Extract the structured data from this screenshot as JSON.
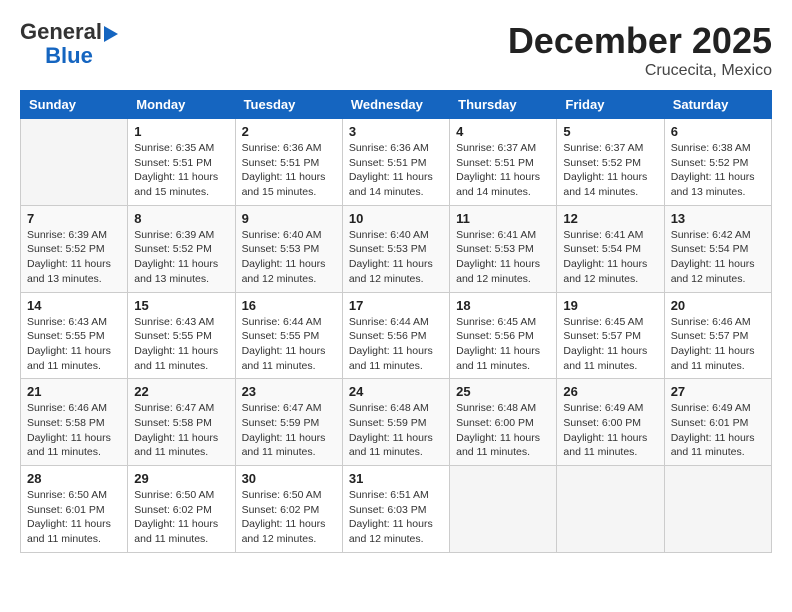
{
  "header": {
    "logo_general": "General",
    "logo_blue": "Blue",
    "month_title": "December 2025",
    "subtitle": "Crucecita, Mexico"
  },
  "weekdays": [
    "Sunday",
    "Monday",
    "Tuesday",
    "Wednesday",
    "Thursday",
    "Friday",
    "Saturday"
  ],
  "weeks": [
    [
      {
        "day": "",
        "sunrise": "",
        "sunset": "",
        "daylight": ""
      },
      {
        "day": "1",
        "sunrise": "Sunrise: 6:35 AM",
        "sunset": "Sunset: 5:51 PM",
        "daylight": "Daylight: 11 hours and 15 minutes."
      },
      {
        "day": "2",
        "sunrise": "Sunrise: 6:36 AM",
        "sunset": "Sunset: 5:51 PM",
        "daylight": "Daylight: 11 hours and 15 minutes."
      },
      {
        "day": "3",
        "sunrise": "Sunrise: 6:36 AM",
        "sunset": "Sunset: 5:51 PM",
        "daylight": "Daylight: 11 hours and 14 minutes."
      },
      {
        "day": "4",
        "sunrise": "Sunrise: 6:37 AM",
        "sunset": "Sunset: 5:51 PM",
        "daylight": "Daylight: 11 hours and 14 minutes."
      },
      {
        "day": "5",
        "sunrise": "Sunrise: 6:37 AM",
        "sunset": "Sunset: 5:52 PM",
        "daylight": "Daylight: 11 hours and 14 minutes."
      },
      {
        "day": "6",
        "sunrise": "Sunrise: 6:38 AM",
        "sunset": "Sunset: 5:52 PM",
        "daylight": "Daylight: 11 hours and 13 minutes."
      }
    ],
    [
      {
        "day": "7",
        "sunrise": "Sunrise: 6:39 AM",
        "sunset": "Sunset: 5:52 PM",
        "daylight": "Daylight: 11 hours and 13 minutes."
      },
      {
        "day": "8",
        "sunrise": "Sunrise: 6:39 AM",
        "sunset": "Sunset: 5:52 PM",
        "daylight": "Daylight: 11 hours and 13 minutes."
      },
      {
        "day": "9",
        "sunrise": "Sunrise: 6:40 AM",
        "sunset": "Sunset: 5:53 PM",
        "daylight": "Daylight: 11 hours and 12 minutes."
      },
      {
        "day": "10",
        "sunrise": "Sunrise: 6:40 AM",
        "sunset": "Sunset: 5:53 PM",
        "daylight": "Daylight: 11 hours and 12 minutes."
      },
      {
        "day": "11",
        "sunrise": "Sunrise: 6:41 AM",
        "sunset": "Sunset: 5:53 PM",
        "daylight": "Daylight: 11 hours and 12 minutes."
      },
      {
        "day": "12",
        "sunrise": "Sunrise: 6:41 AM",
        "sunset": "Sunset: 5:54 PM",
        "daylight": "Daylight: 11 hours and 12 minutes."
      },
      {
        "day": "13",
        "sunrise": "Sunrise: 6:42 AM",
        "sunset": "Sunset: 5:54 PM",
        "daylight": "Daylight: 11 hours and 12 minutes."
      }
    ],
    [
      {
        "day": "14",
        "sunrise": "Sunrise: 6:43 AM",
        "sunset": "Sunset: 5:55 PM",
        "daylight": "Daylight: 11 hours and 11 minutes."
      },
      {
        "day": "15",
        "sunrise": "Sunrise: 6:43 AM",
        "sunset": "Sunset: 5:55 PM",
        "daylight": "Daylight: 11 hours and 11 minutes."
      },
      {
        "day": "16",
        "sunrise": "Sunrise: 6:44 AM",
        "sunset": "Sunset: 5:55 PM",
        "daylight": "Daylight: 11 hours and 11 minutes."
      },
      {
        "day": "17",
        "sunrise": "Sunrise: 6:44 AM",
        "sunset": "Sunset: 5:56 PM",
        "daylight": "Daylight: 11 hours and 11 minutes."
      },
      {
        "day": "18",
        "sunrise": "Sunrise: 6:45 AM",
        "sunset": "Sunset: 5:56 PM",
        "daylight": "Daylight: 11 hours and 11 minutes."
      },
      {
        "day": "19",
        "sunrise": "Sunrise: 6:45 AM",
        "sunset": "Sunset: 5:57 PM",
        "daylight": "Daylight: 11 hours and 11 minutes."
      },
      {
        "day": "20",
        "sunrise": "Sunrise: 6:46 AM",
        "sunset": "Sunset: 5:57 PM",
        "daylight": "Daylight: 11 hours and 11 minutes."
      }
    ],
    [
      {
        "day": "21",
        "sunrise": "Sunrise: 6:46 AM",
        "sunset": "Sunset: 5:58 PM",
        "daylight": "Daylight: 11 hours and 11 minutes."
      },
      {
        "day": "22",
        "sunrise": "Sunrise: 6:47 AM",
        "sunset": "Sunset: 5:58 PM",
        "daylight": "Daylight: 11 hours and 11 minutes."
      },
      {
        "day": "23",
        "sunrise": "Sunrise: 6:47 AM",
        "sunset": "Sunset: 5:59 PM",
        "daylight": "Daylight: 11 hours and 11 minutes."
      },
      {
        "day": "24",
        "sunrise": "Sunrise: 6:48 AM",
        "sunset": "Sunset: 5:59 PM",
        "daylight": "Daylight: 11 hours and 11 minutes."
      },
      {
        "day": "25",
        "sunrise": "Sunrise: 6:48 AM",
        "sunset": "Sunset: 6:00 PM",
        "daylight": "Daylight: 11 hours and 11 minutes."
      },
      {
        "day": "26",
        "sunrise": "Sunrise: 6:49 AM",
        "sunset": "Sunset: 6:00 PM",
        "daylight": "Daylight: 11 hours and 11 minutes."
      },
      {
        "day": "27",
        "sunrise": "Sunrise: 6:49 AM",
        "sunset": "Sunset: 6:01 PM",
        "daylight": "Daylight: 11 hours and 11 minutes."
      }
    ],
    [
      {
        "day": "28",
        "sunrise": "Sunrise: 6:50 AM",
        "sunset": "Sunset: 6:01 PM",
        "daylight": "Daylight: 11 hours and 11 minutes."
      },
      {
        "day": "29",
        "sunrise": "Sunrise: 6:50 AM",
        "sunset": "Sunset: 6:02 PM",
        "daylight": "Daylight: 11 hours and 11 minutes."
      },
      {
        "day": "30",
        "sunrise": "Sunrise: 6:50 AM",
        "sunset": "Sunset: 6:02 PM",
        "daylight": "Daylight: 11 hours and 12 minutes."
      },
      {
        "day": "31",
        "sunrise": "Sunrise: 6:51 AM",
        "sunset": "Sunset: 6:03 PM",
        "daylight": "Daylight: 11 hours and 12 minutes."
      },
      {
        "day": "",
        "sunrise": "",
        "sunset": "",
        "daylight": ""
      },
      {
        "day": "",
        "sunrise": "",
        "sunset": "",
        "daylight": ""
      },
      {
        "day": "",
        "sunrise": "",
        "sunset": "",
        "daylight": ""
      }
    ]
  ]
}
